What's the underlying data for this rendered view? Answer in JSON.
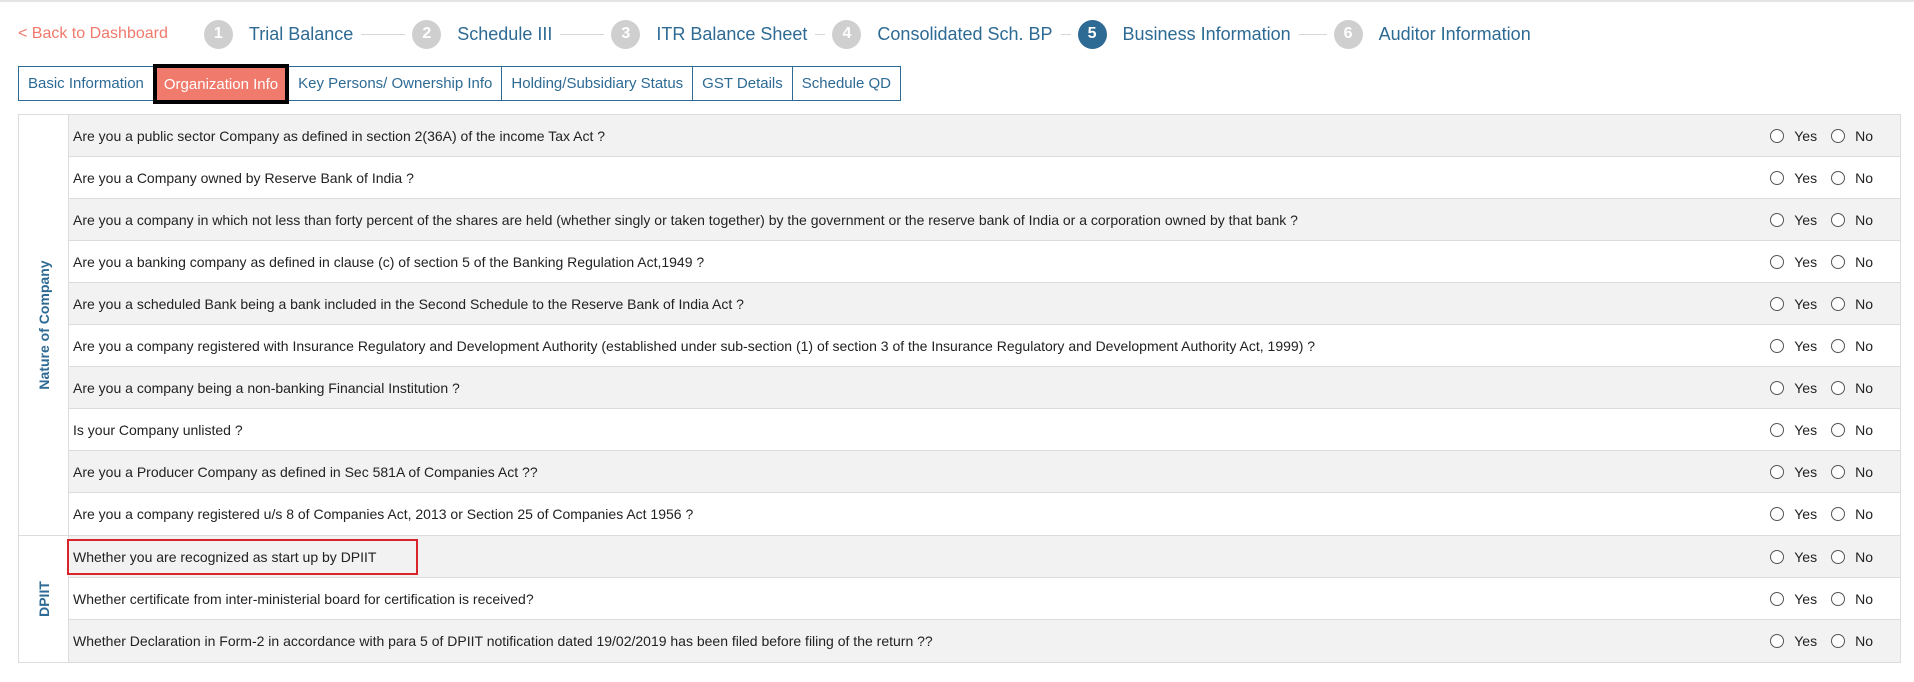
{
  "nav": {
    "back_label": "< Back to Dashboard",
    "steps": [
      {
        "num": "1",
        "label": "Trial Balance"
      },
      {
        "num": "2",
        "label": "Schedule III"
      },
      {
        "num": "3",
        "label": "ITR Balance Sheet"
      },
      {
        "num": "4",
        "label": "Consolidated Sch. BP"
      },
      {
        "num": "5",
        "label": "Business Information"
      },
      {
        "num": "6",
        "label": "Auditor Information"
      }
    ],
    "active_step": "5"
  },
  "tabs": [
    "Basic Information",
    "Organization Info",
    "Key Persons/ Ownership Info",
    "Holding/Subsidiary Status",
    "GST Details",
    "Schedule QD"
  ],
  "active_tab": "Organization Info",
  "options": {
    "yes": "Yes",
    "no": "No"
  },
  "groups": [
    {
      "label": "Nature of Company",
      "questions": [
        "Are you a public sector Company as defined in section 2(36A) of the income Tax Act ?",
        "Are you a Company owned by Reserve Bank of India ?",
        "Are you a company in which not less than forty percent of the shares are held (whether singly or taken together) by the government or the reserve bank of India or a corporation owned by that bank ?",
        "Are you a banking company as defined in clause (c) of section 5 of the Banking Regulation Act,1949 ?",
        "Are you a scheduled Bank being a bank included in the Second Schedule to the Reserve Bank of India Act ?",
        "Are you a company registered with Insurance Regulatory and Development Authority (established under sub-section (1) of section 3 of the Insurance Regulatory and Development Authority Act, 1999) ?",
        "Are you a company being a non-banking Financial Institution ?",
        "Is your Company unlisted ?",
        "Are you a Producer Company as defined in Sec 581A of Companies Act ??",
        "Are you a company registered u/s 8 of Companies Act, 2013 or Section 25 of Companies Act 1956 ?"
      ]
    },
    {
      "label": "DPIIT",
      "questions": [
        "Whether you are recognized as start up by DPIIT",
        "Whether certificate from inter-ministerial board for certification is received?",
        "Whether Declaration in Form-2 in accordance with para 5 of DPIIT notification dated 19/02/2019 has been filed before filing of the return ??"
      ]
    }
  ],
  "highlight_color": "#d9242b",
  "accent_color": "#2d6a94",
  "active_tab_color": "#f07a6c"
}
